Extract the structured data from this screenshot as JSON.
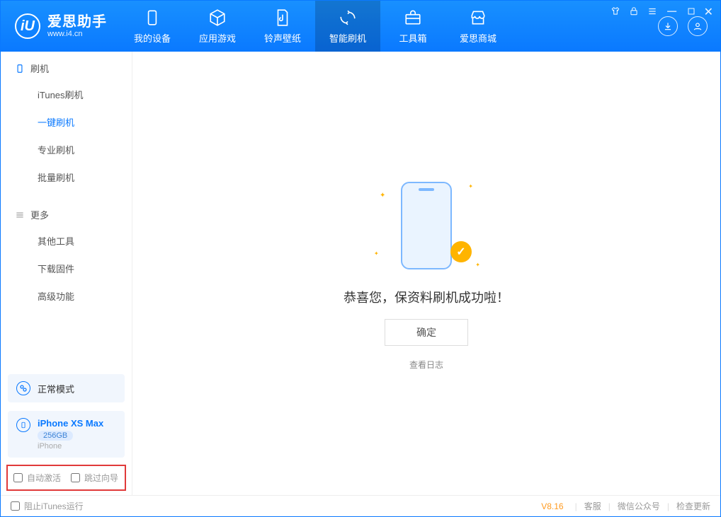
{
  "app": {
    "name_cn": "爱思助手",
    "name_en": "www.i4.cn"
  },
  "topnav": [
    {
      "label": "我的设备"
    },
    {
      "label": "应用游戏"
    },
    {
      "label": "铃声壁纸"
    },
    {
      "label": "智能刷机"
    },
    {
      "label": "工具箱"
    },
    {
      "label": "爱思商城"
    }
  ],
  "sidebar": {
    "section1": {
      "title": "刷机",
      "items": [
        "iTunes刷机",
        "一键刷机",
        "专业刷机",
        "批量刷机"
      ]
    },
    "section2": {
      "title": "更多",
      "items": [
        "其他工具",
        "下载固件",
        "高级功能"
      ]
    },
    "mode_label": "正常模式",
    "device": {
      "name": "iPhone XS Max",
      "capacity": "256GB",
      "type": "iPhone"
    },
    "opt1": "自动激活",
    "opt2": "跳过向导"
  },
  "main": {
    "success_text": "恭喜您，保资料刷机成功啦！",
    "ok_label": "确定",
    "log_link": "查看日志"
  },
  "statusbar": {
    "block_itunes": "阻止iTunes运行",
    "version": "V8.16",
    "link1": "客服",
    "link2": "微信公众号",
    "link3": "检查更新"
  }
}
